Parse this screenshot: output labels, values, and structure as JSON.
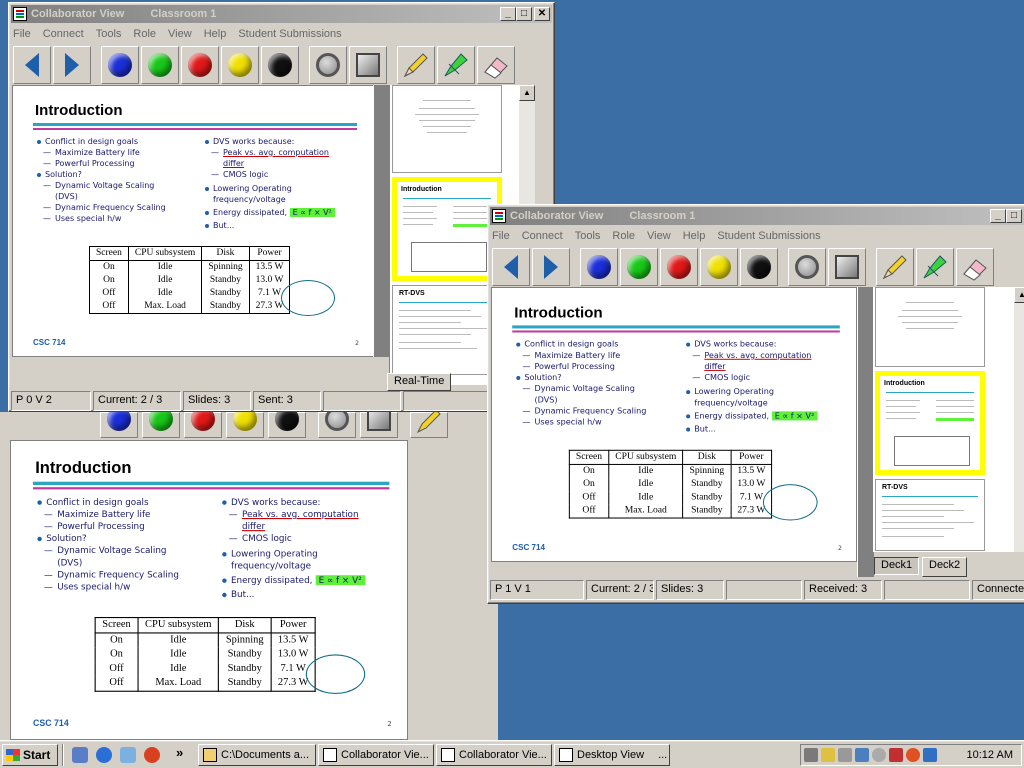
{
  "windows": {
    "back": {
      "title": "Collaborator View",
      "subtitle": "Classroom 1",
      "menu": [
        "File",
        "Connect",
        "Tools",
        "Role",
        "View",
        "Help",
        "Student Submissions"
      ],
      "status": [
        "P 0 V 2",
        "Current: 2 / 3",
        "Slides: 3",
        "Sent: 3",
        "",
        ""
      ],
      "tab_label": "Real-Time"
    },
    "front": {
      "title": "Collaborator View",
      "subtitle": "Classroom 1",
      "menu": [
        "File",
        "Connect",
        "Tools",
        "Role",
        "View",
        "Help",
        "Student Submissions"
      ],
      "status": [
        "P 1 V 1",
        "Current: 2 / 3",
        "Slides: 3",
        "",
        "Received: 3",
        "",
        "Connecte"
      ],
      "tabs": [
        "Deck1",
        "Deck2"
      ]
    },
    "title_buttons": {
      "minimize": "_",
      "maximize": "□",
      "close": "✕"
    }
  },
  "toolbar": {
    "nav": [
      "back-arrow-icon",
      "forward-arrow-icon"
    ],
    "colors": [
      {
        "name": "blue",
        "hex": "#1a2fd8"
      },
      {
        "name": "green",
        "hex": "#18c818"
      },
      {
        "name": "red",
        "hex": "#e01818"
      },
      {
        "name": "yellow",
        "hex": "#f0e000"
      },
      {
        "name": "black",
        "hex": "#101010"
      }
    ],
    "tools": [
      "ring-tool-icon",
      "square-tool-icon",
      "pencil-icon",
      "highlighter-icon",
      "eraser-icon"
    ]
  },
  "slide": {
    "title": "Introduction",
    "left": [
      {
        "level": 1,
        "text": "Conflict in design goals"
      },
      {
        "level": 2,
        "text": "Maximize Battery life"
      },
      {
        "level": 2,
        "text": "Powerful Processing"
      },
      {
        "level": 1,
        "text": "Solution?"
      },
      {
        "level": 2,
        "text": "Dynamic Voltage Scaling (DVS)"
      },
      {
        "level": 2,
        "text": "Dynamic Frequency Scaling"
      },
      {
        "level": 2,
        "text": "Uses special h/w"
      }
    ],
    "right": {
      "dvs": "DVS works because:",
      "peak": "Peak vs. avg. computation differ",
      "cmos": "CMOS logic",
      "lowering": "Lowering Operating frequency/voltage",
      "energy": "Energy dissipated,",
      "formula": "E ∝ f × V²",
      "but": "But..."
    },
    "table": {
      "headers": [
        "Screen",
        "CPU subsystem",
        "Disk",
        "Power"
      ],
      "rows": [
        [
          "On",
          "Idle",
          "Spinning",
          "13.5 W"
        ],
        [
          "On",
          "Idle",
          "Standby",
          "13.0 W"
        ],
        [
          "Off",
          "Idle",
          "Standby",
          "7.1 W"
        ],
        [
          "Off",
          "Max. Load",
          "Standby",
          "27.3 W"
        ]
      ]
    },
    "footer": "CSC 714",
    "page": "2"
  },
  "thumbnails": {
    "t2_title": "Introduction",
    "t3_title": "RT-DVS"
  },
  "taskbar": {
    "start": "Start",
    "chevron": "»",
    "buttons": [
      "C:\\Documents a...",
      "Collaborator Vie...",
      "Collaborator Vie...",
      "Desktop View"
    ],
    "more": "...",
    "time": "10:12 AM"
  }
}
